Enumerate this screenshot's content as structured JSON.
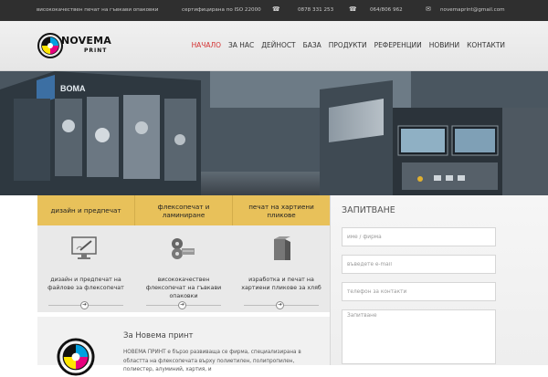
{
  "topbar": {
    "tagline": "висококачествен печат на гъвкави опаковки",
    "certification": "сертифицирана по ISO 22000",
    "phone1": "0878 331 253",
    "phone2": "064/806 962",
    "email": "novemaprint@gmail.com"
  },
  "logo": {
    "name": "NOVEMA",
    "sub": "PRINT"
  },
  "nav": {
    "items": [
      {
        "label": "НАЧАЛО"
      },
      {
        "label": "ЗА НАС"
      },
      {
        "label": "ДЕЙНОСТ"
      },
      {
        "label": "БАЗА"
      },
      {
        "label": "ПРОДУКТИ"
      },
      {
        "label": "РЕФЕРЕНЦИИ"
      },
      {
        "label": "НОВИНИ"
      },
      {
        "label": "КОНТАКТИ"
      }
    ],
    "active_color": "#d32f2f"
  },
  "hero": {
    "machine_brand": "BOMA"
  },
  "tabs": [
    {
      "label": "дизайн и предпечат"
    },
    {
      "label": "флексопечат и ламиниране"
    },
    {
      "label": "печат на хартиени пликове"
    }
  ],
  "features": [
    {
      "icon": "monitor-design-icon",
      "caption": "дизайн и предпечат на файлове за флексопечат"
    },
    {
      "icon": "printing-rollers-icon",
      "caption": "висококачествен флексопечат на гъвкави опаковки"
    },
    {
      "icon": "paper-bag-icon",
      "caption": "изработка и печат на хартиени пликове за хляб"
    }
  ],
  "about": {
    "title": "За Новема принт",
    "text": "НОВЕМА ПРИНТ е бързо развиваща се фирма, специализирана в областта на флексопечата върху полиетилен, полипропилен, полиестер, алуминий, хартия, и"
  },
  "form": {
    "title": "ЗАПИТВАНЕ",
    "name_placeholder": "име / фирма",
    "email_placeholder": "въведете e-mail",
    "phone_placeholder": "телефон за контакти",
    "message_placeholder": "Запитване"
  },
  "colors": {
    "accent": "#e8c15a",
    "topbar": "#2f2f2f",
    "nav_active": "#d32f2f"
  }
}
